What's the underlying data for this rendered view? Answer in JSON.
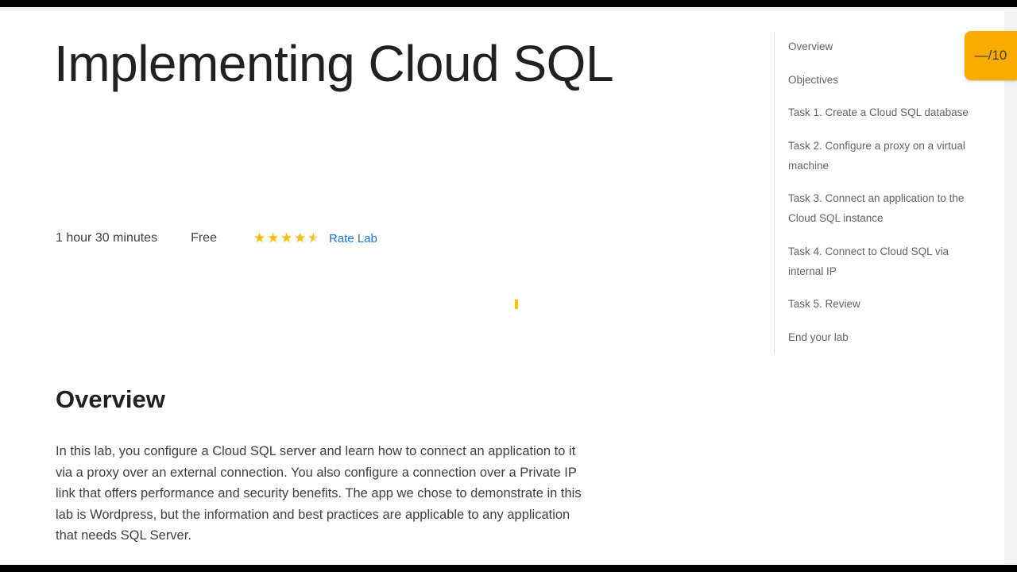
{
  "lab": {
    "title": "Implementing Cloud SQL",
    "duration": "1 hour 30 minutes",
    "cost": "Free",
    "rating": 4.5,
    "rate_label": "Rate Lab"
  },
  "score_badge": "—/10",
  "overview": {
    "heading": "Overview",
    "text": "In this lab, you configure a Cloud SQL server and learn how to connect an application to it via a proxy over an external connection. You also configure a connection over a Private IP link that offers performance and security benefits. The app we chose to demonstrate in this lab is Wordpress, but the information and best practices are applicable to any application that needs SQL Server."
  },
  "toc": [
    "Overview",
    "Objectives",
    "Task 1. Create a Cloud SQL database",
    "Task 2. Configure a proxy on a virtual machine",
    "Task 3. Connect an application to the Cloud SQL instance",
    "Task 4. Connect to Cloud SQL via internal IP",
    "Task 5. Review",
    "End your lab"
  ],
  "colors": {
    "accent_link": "#1a73e8",
    "star": "#fbbc04",
    "badge": "#f9ab00"
  },
  "icons": [
    "star-icon",
    "half-star-icon"
  ]
}
